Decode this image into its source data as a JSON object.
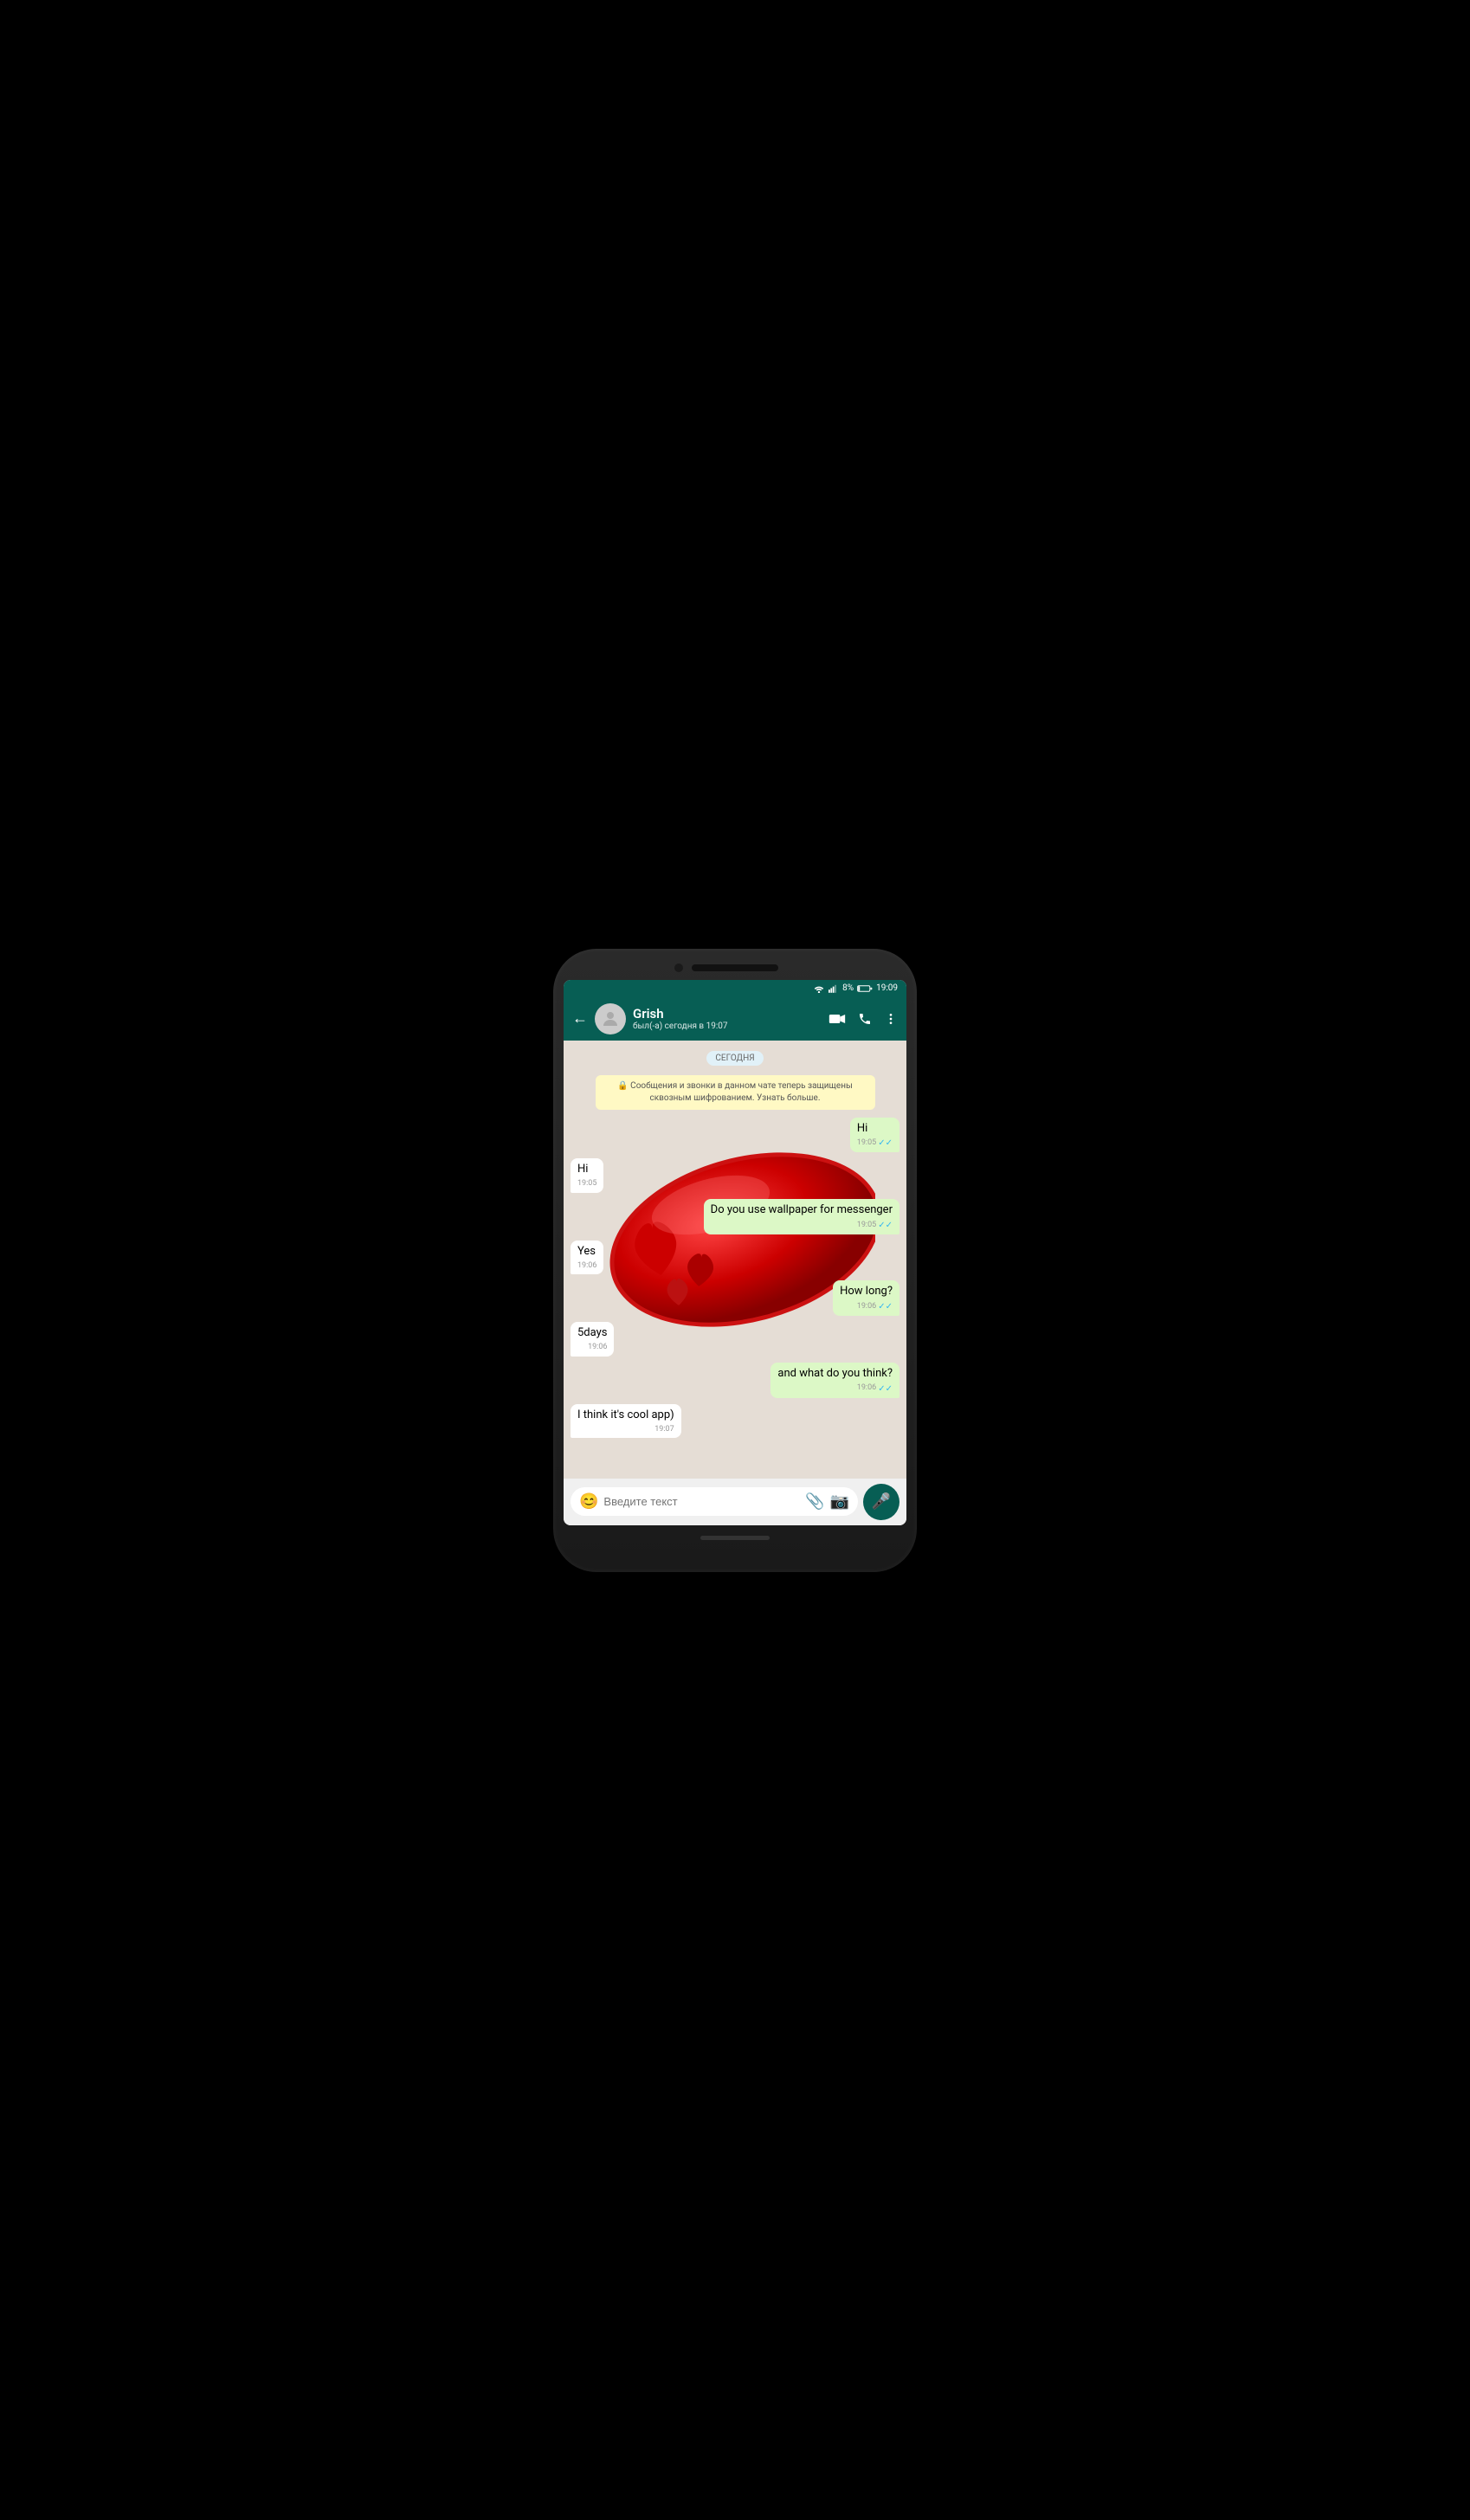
{
  "phone": {
    "status_bar": {
      "wifi": "wifi",
      "signal": "signal",
      "battery": "8%",
      "time": "19:09"
    },
    "app_bar": {
      "back_label": "←",
      "contact_name": "Grish",
      "contact_status": "был(-а) сегодня в 19:07",
      "video_call_icon": "video-camera",
      "voice_call_icon": "phone",
      "menu_icon": "more-vertical"
    },
    "chat": {
      "date_badge": "СЕГОДНЯ",
      "system_message": "🔒 Сообщения и звонки в данном чате теперь защищены сквозным шифрованием. Узнать больше.",
      "messages": [
        {
          "id": 1,
          "type": "out",
          "text": "Hi",
          "time": "19:05",
          "status": "read"
        },
        {
          "id": 2,
          "type": "in",
          "text": "Hi",
          "time": "19:05",
          "status": ""
        },
        {
          "id": 3,
          "type": "out",
          "text": "Do you use wallpaper for messenger",
          "time": "19:05",
          "status": "read"
        },
        {
          "id": 4,
          "type": "in",
          "text": "Yes",
          "time": "19:06",
          "status": ""
        },
        {
          "id": 5,
          "type": "out",
          "text": "How long?",
          "time": "19:06",
          "status": "read"
        },
        {
          "id": 6,
          "type": "in",
          "text": "5days",
          "time": "19:06",
          "status": ""
        },
        {
          "id": 7,
          "type": "out",
          "text": "and what do you think?",
          "time": "19:06",
          "status": "read"
        },
        {
          "id": 8,
          "type": "in",
          "text": "I think it's cool app)",
          "time": "19:07",
          "status": ""
        }
      ]
    },
    "input_bar": {
      "placeholder": "Введите текст",
      "emoji_label": "😊",
      "attachment_label": "📎",
      "camera_label": "📷",
      "mic_label": "🎤"
    }
  }
}
